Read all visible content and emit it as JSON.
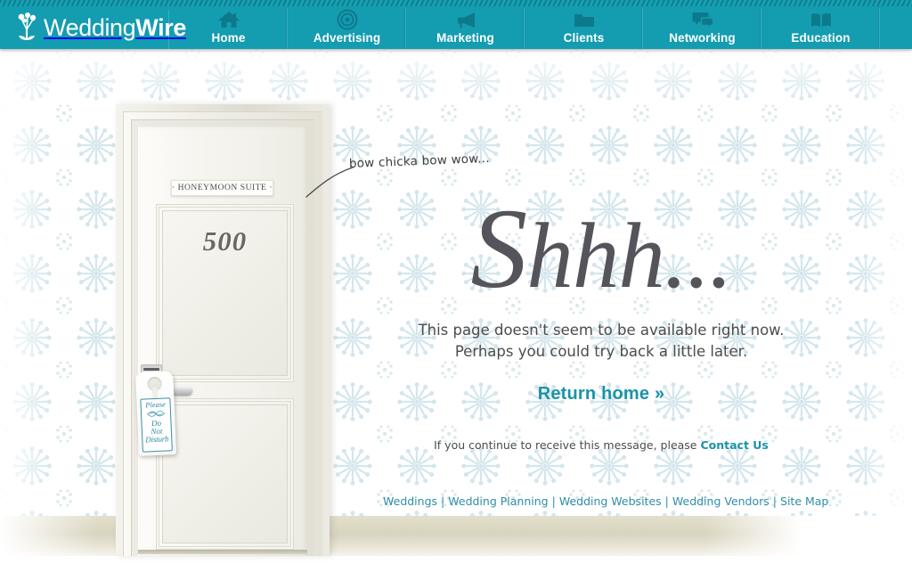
{
  "header": {
    "logo": {
      "icon": "bouquet-icon",
      "text_light": "Wedding",
      "text_bold": "Wire",
      "full_text": "WeddingWire"
    },
    "nav_items": [
      {
        "label": "Home",
        "icon": "house-icon"
      },
      {
        "label": "Advertising",
        "icon": "target-icon"
      },
      {
        "label": "Marketing",
        "icon": "megaphone-icon"
      },
      {
        "label": "Clients",
        "icon": "folder-icon"
      },
      {
        "label": "Networking",
        "icon": "speech-bubbles-icon"
      },
      {
        "label": "Education",
        "icon": "open-book-icon"
      }
    ]
  },
  "door": {
    "plaque_text": "· HONEYMOON SUITE ·",
    "room_number": "500",
    "hanger": {
      "line1": "Please",
      "line2": "Do",
      "line3": "Not",
      "line4": "Disturb",
      "ornament": "flourish-icon"
    },
    "handle_icon": "door-lever-handle-icon",
    "card_slot_icon": "key-card-slot-icon"
  },
  "annotation": {
    "text": "bow chicka bow wow...",
    "leader_icon": "curved-leader-line-icon"
  },
  "main": {
    "headline_cap": "S",
    "headline_rest": "hhh...",
    "headline_full": "Shhh...",
    "message_line1": "This page doesn't seem to be available right now.",
    "message_line2": "Perhaps you could try back a little later.",
    "return_home_label": "Return home »",
    "contact_prefix": "If you continue to receive this message, please ",
    "contact_link_label": "Contact Us"
  },
  "footer": {
    "separator": "|",
    "links": [
      "Weddings",
      "Wedding Planning",
      "Wedding Websites",
      "Wedding Vendors",
      "Site Map"
    ]
  },
  "colors": {
    "brand_teal": "#149cb0",
    "top_stripe_dark": "#0d7f90",
    "nav_icon_teal": "#0d7a8c",
    "link_teal": "#1b93a8",
    "footer_link_teal": "#2e8fa6",
    "headline_gray": "#55545a",
    "body_gray": "#4c4c4c",
    "wall_pattern_blue": "#d3e6ec",
    "door_cream": "#f6f5f0",
    "baseboard_tan": "#d8d4be",
    "hanger_teal": "#2d8ba0"
  }
}
